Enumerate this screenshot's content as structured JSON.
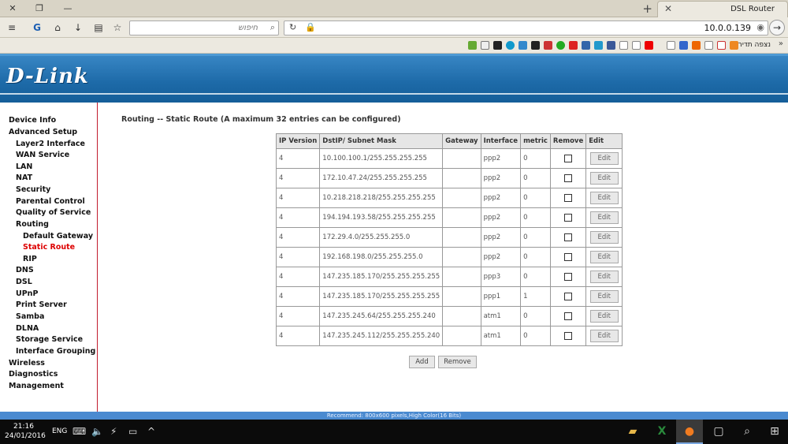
{
  "browser": {
    "tab_title": "DSL Router",
    "search_placeholder": "חיפוש",
    "url": "10.0.0.139",
    "bookmark_folder": "נצפה תדיר"
  },
  "menu": {
    "items": [
      {
        "label": "Device Info",
        "level": 0
      },
      {
        "label": "Advanced Setup",
        "level": 0
      },
      {
        "label": "Layer2 Interface",
        "level": 1
      },
      {
        "label": "WAN Service",
        "level": 1
      },
      {
        "label": "LAN",
        "level": 1
      },
      {
        "label": "NAT",
        "level": 1
      },
      {
        "label": "Security",
        "level": 1
      },
      {
        "label": "Parental Control",
        "level": 1
      },
      {
        "label": "Quality of Service",
        "level": 1
      },
      {
        "label": "Routing",
        "level": 1
      },
      {
        "label": "Default Gateway",
        "level": 2
      },
      {
        "label": "Static Route",
        "level": 2,
        "active": true
      },
      {
        "label": "RIP",
        "level": 2
      },
      {
        "label": "DNS",
        "level": 1
      },
      {
        "label": "DSL",
        "level": 1
      },
      {
        "label": "UPnP",
        "level": 1
      },
      {
        "label": "Print Server",
        "level": 1
      },
      {
        "label": "Samba",
        "level": 1
      },
      {
        "label": "DLNA",
        "level": 1
      },
      {
        "label": "Storage Service",
        "level": 1
      },
      {
        "label": "Interface Grouping",
        "level": 1
      },
      {
        "label": "Wireless",
        "level": 0
      },
      {
        "label": "Diagnostics",
        "level": 0
      },
      {
        "label": "Management",
        "level": 0
      }
    ],
    "active_color": "#dd0000"
  },
  "logo": "D-Link",
  "page": {
    "heading": "Routing -- Static Route (A maximum 32 entries can be configured)",
    "columns": [
      "IP Version",
      "DstIP/ Subnet Mask",
      "Gateway",
      "Interface",
      "metric",
      "Remove",
      "Edit"
    ],
    "edit_label": "Edit",
    "rows": [
      {
        "ipver": "4",
        "dst": "10.100.100.1/255.255.255.255",
        "gateway": "",
        "iface": "ppp2",
        "metric": "0"
      },
      {
        "ipver": "4",
        "dst": "172.10.47.24/255.255.255.255",
        "gateway": "",
        "iface": "ppp2",
        "metric": "0"
      },
      {
        "ipver": "4",
        "dst": "10.218.218.218/255.255.255.255",
        "gateway": "",
        "iface": "ppp2",
        "metric": "0"
      },
      {
        "ipver": "4",
        "dst": "194.194.193.58/255.255.255.255",
        "gateway": "",
        "iface": "ppp2",
        "metric": "0"
      },
      {
        "ipver": "4",
        "dst": "172.29.4.0/255.255.255.0",
        "gateway": "",
        "iface": "ppp2",
        "metric": "0"
      },
      {
        "ipver": "4",
        "dst": "192.168.198.0/255.255.255.0",
        "gateway": "",
        "iface": "ppp2",
        "metric": "0"
      },
      {
        "ipver": "4",
        "dst": "147.235.185.170/255.255.255.255",
        "gateway": "",
        "iface": "ppp3",
        "metric": "0"
      },
      {
        "ipver": "4",
        "dst": "147.235.185.170/255.255.255.255",
        "gateway": "",
        "iface": "ppp1",
        "metric": "1"
      },
      {
        "ipver": "4",
        "dst": "147.235.245.64/255.255.255.240",
        "gateway": "",
        "iface": "atm1",
        "metric": "0"
      },
      {
        "ipver": "4",
        "dst": "147.235.245.112/255.255.255.240",
        "gateway": "",
        "iface": "atm1",
        "metric": "0"
      }
    ],
    "add_label": "Add",
    "remove_label": "Remove"
  },
  "recommend": "Recommend: 800x600 pixels,High Color(16 Bits)",
  "taskbar": {
    "time": "21:16",
    "date": "24/01/2016",
    "lang": "ENG"
  },
  "colors": {
    "header_blue": "#1d6aa8",
    "sidebar_border": "#c21d2e",
    "recommend_bar": "#4a8ad0"
  }
}
